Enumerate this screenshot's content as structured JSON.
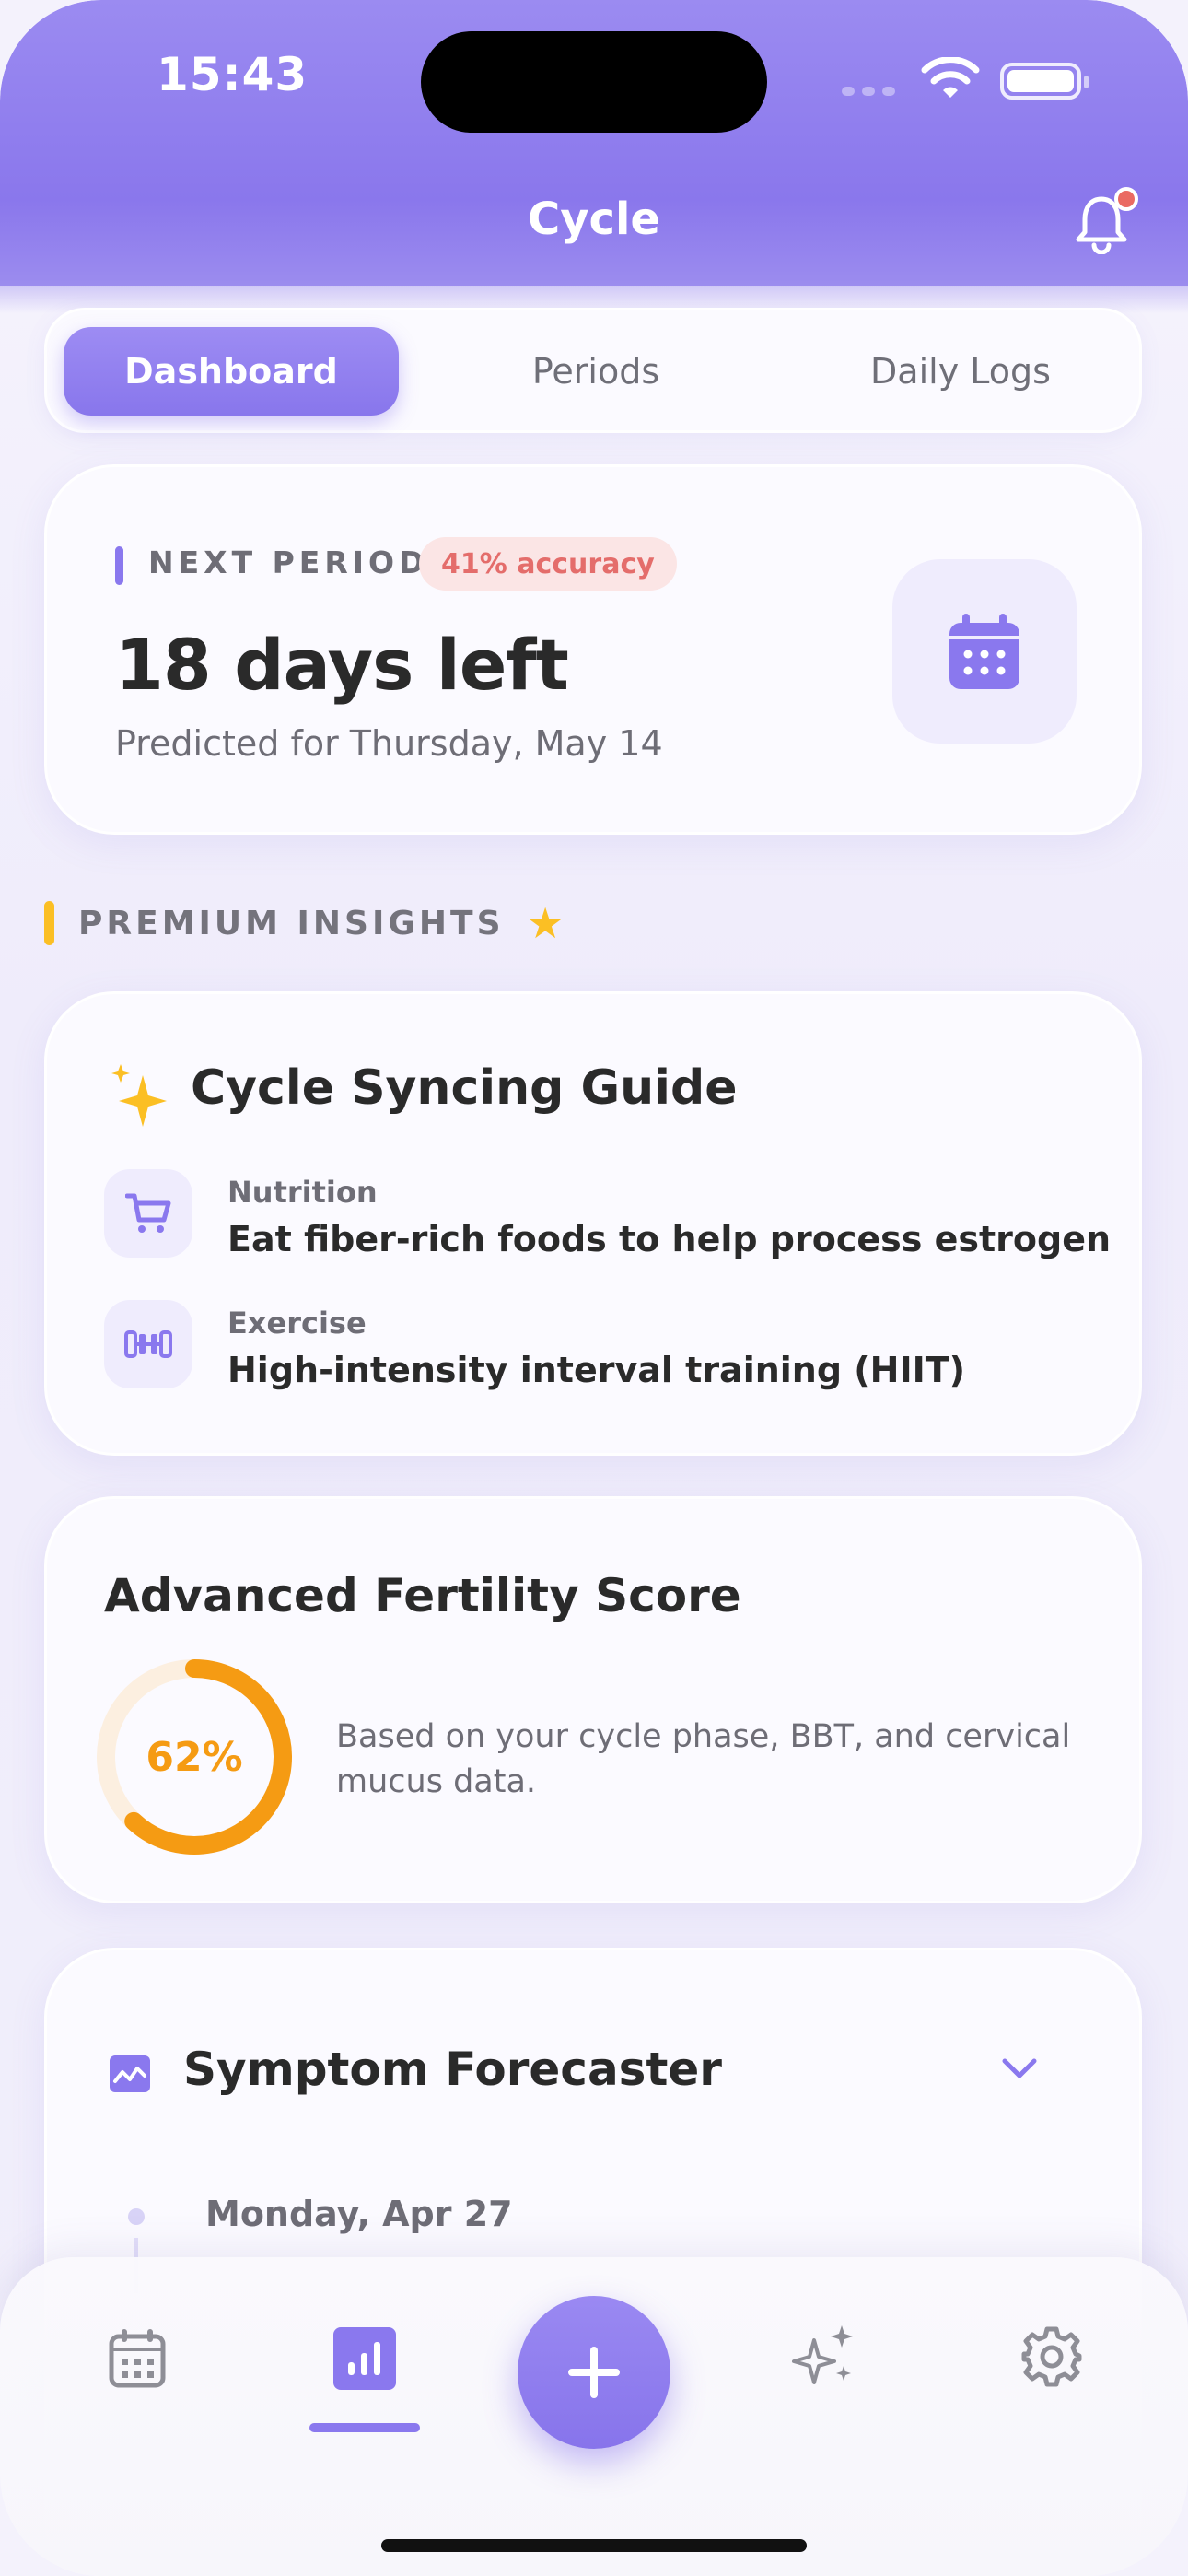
{
  "status_bar": {
    "time": "15:43"
  },
  "header": {
    "title": "Cycle"
  },
  "tabs": [
    {
      "label": "Dashboard",
      "active": true
    },
    {
      "label": "Periods",
      "active": false
    },
    {
      "label": "Daily Logs",
      "active": false
    }
  ],
  "next_period": {
    "label": "NEXT PERIOD",
    "accuracy": "41% accuracy",
    "days_left": "18 days left",
    "predicted": "Predicted for Thursday, May 14"
  },
  "premium_section": {
    "label": "PREMIUM INSIGHTS",
    "star": "★"
  },
  "cycle_syncing": {
    "title": "Cycle Syncing Guide",
    "items": [
      {
        "icon": "cart-icon",
        "label": "Nutrition",
        "text": "Eat fiber-rich foods to help process estrogen"
      },
      {
        "icon": "dumbbell-icon",
        "label": "Exercise",
        "text": "High-intensity interval training (HIIT)"
      }
    ]
  },
  "fertility": {
    "title": "Advanced Fertility Score",
    "score_label": "62%",
    "score": 0.62,
    "description": "Based on your cycle phase, BBT, and cervical mucus data."
  },
  "symptom_forecaster": {
    "title": "Symptom Forecaster",
    "first_date": "Monday, Apr 27"
  },
  "bottom_nav": {
    "items": [
      "calendar-icon",
      "stats-icon",
      "add-icon",
      "sparkles-icon",
      "gear-icon"
    ],
    "active": "stats-icon"
  },
  "colors": {
    "accent": "#8a78ee",
    "warning": "#f59b13",
    "badge": "#e46d6b",
    "premium": "#fbbf24"
  }
}
